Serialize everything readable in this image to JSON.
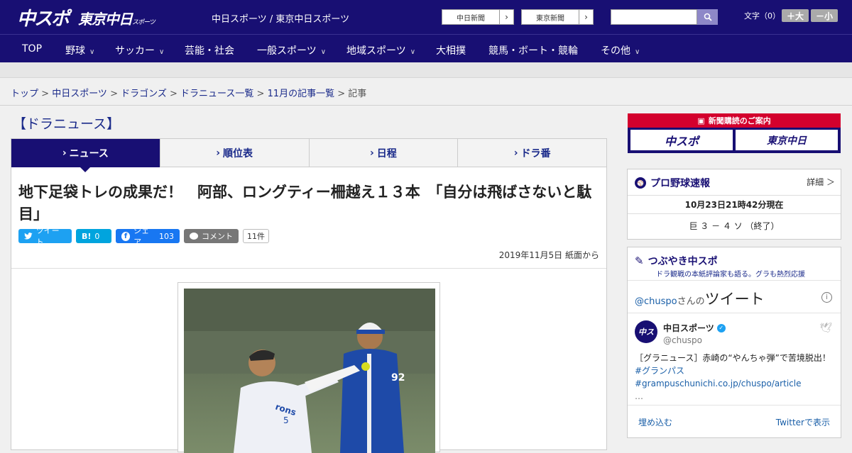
{
  "header": {
    "logo_main": "中スポ",
    "logo_tokyo": "東京中日",
    "logo_tokyo_small": "スポーツ",
    "site_link": "中日スポーツ / 東京中日スポーツ",
    "paper_btn_1": "中日新聞",
    "paper_btn_2": "東京新聞",
    "search_placeholder": "",
    "fontsize_label": "文字（0）",
    "font_larger": "＋大",
    "font_smaller": "－小"
  },
  "nav": {
    "items": [
      "TOP",
      "野球",
      "サッカー",
      "芸能・社会",
      "一般スポーツ",
      "地域スポーツ",
      "大相撲",
      "競馬・ボート・競輪",
      "その他"
    ]
  },
  "breadcrumb": {
    "items": [
      "トップ",
      "中日スポーツ",
      "ドラゴンズ",
      "ドラニュース一覧",
      "11月の記事一覧"
    ],
    "current": "記事"
  },
  "section_title": "【ドラニュース】",
  "tabs": [
    "ニュース",
    "順位表",
    "日程",
    "ドラ番"
  ],
  "article": {
    "headline": "地下足袋トレの成果だ！　阿部、ロングティー柵越え１３本　「自分は飛ばさないと駄目」",
    "tweet_label": "ツイート",
    "hatena_label": "B!",
    "hatena_count": "0",
    "share_label": "シェア",
    "share_count": "103",
    "comment_label": "コメント",
    "comment_count": "11件",
    "date": "2019年11月5日 紙面から"
  },
  "sidebar": {
    "ad_header": "新聞購読のご案内",
    "ad_logo_1": "中スポ",
    "ad_logo_2": "東京中日",
    "score_title": "プロ野球速報",
    "score_detail": "詳細 ＞",
    "score_time": "10月23日21時42分現在",
    "score_line": "巨 ３ － ４ ソ （終了）",
    "tw_title": "つぶやき中スポ",
    "tw_subtitle": "ドラ観戦の本紙評論家も語る。グラも熱烈応援",
    "tw_handle_link": "@chuspo",
    "tw_san": "さんの",
    "tw_tweets": "ツイート",
    "tw_name": "中日スポーツ",
    "tw_handle": "@chuspo",
    "tw_body_1": "［グラニュース］赤崎の“やんちゃ弾”で苦境脱出！",
    "tw_body_2": "#グランパス #grampuschunichi.co.jp/chuspo/article",
    "tw_body_3": "…",
    "tw_embed": "埋め込む",
    "tw_view": "Twitterで表示"
  },
  "colors": {
    "brand_navy": "#180f73",
    "accent_red": "#d3002d",
    "twitter_blue": "#1da1f2",
    "hatena_blue": "#00a4de",
    "facebook_blue": "#1877f2"
  }
}
